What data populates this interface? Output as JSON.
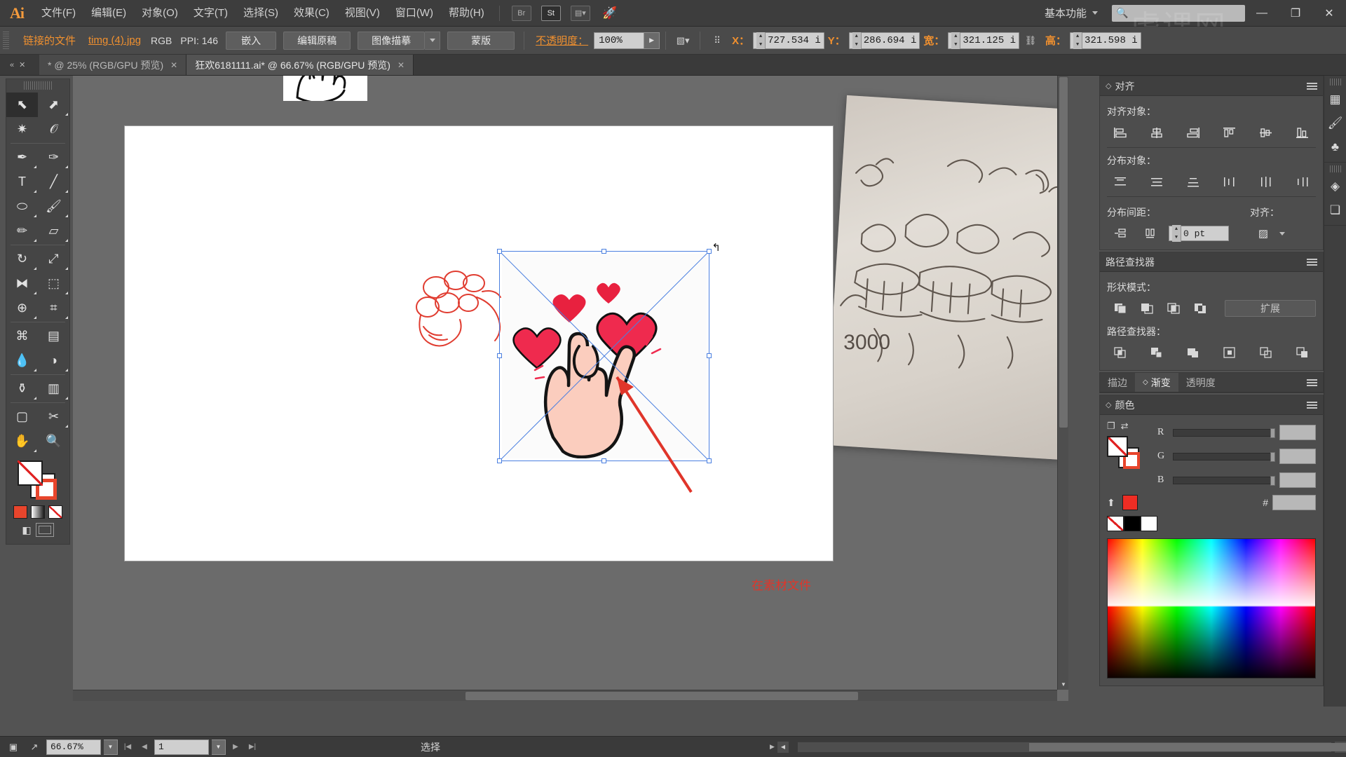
{
  "app": {
    "name": "Ai",
    "logo_text": "Ai"
  },
  "menubar": {
    "items": [
      {
        "label": "文件(F)"
      },
      {
        "label": "编辑(E)"
      },
      {
        "label": "对象(O)"
      },
      {
        "label": "文字(T)"
      },
      {
        "label": "选择(S)"
      },
      {
        "label": "效果(C)"
      },
      {
        "label": "视图(V)"
      },
      {
        "label": "窗口(W)"
      },
      {
        "label": "帮助(H)"
      }
    ],
    "bridge_label": "Br",
    "stock_label": "St",
    "arrange_icon": "arrange-documents-icon",
    "rocket_icon": "rocket-icon",
    "workspace": "基本功能",
    "search_placeholder": "",
    "window_buttons": {
      "minimize": "—",
      "restore": "❐",
      "close": "✕"
    },
    "watermark": "虎课网"
  },
  "controlbar": {
    "linked_file_label": "链接的文件",
    "filename": "timg (4).jpg",
    "colormode": "RGB",
    "ppi_label": "PPI: 146",
    "embed_button": "嵌入",
    "edit_original_button": "编辑原稿",
    "image_trace_button": "图像描摹",
    "mask_button": "蒙版",
    "opacity_label": "不透明度：",
    "opacity_value": "100%",
    "transform_icon": "transform-icon",
    "reference_point_icon": "reference-point-grid-icon",
    "x_label": "X：",
    "x_value": "727.534 i",
    "y_label": "Y：",
    "y_value": "286.694 i",
    "w_label": "宽：",
    "w_value": "321.125 i",
    "link_icon": "constrain-proportions-icon",
    "h_label": "高：",
    "h_value": "321.598 i"
  },
  "tabbar": {
    "nav_prev": "«",
    "nav_close": "✕",
    "tabs": [
      {
        "label": "* @ 25% (RGB/GPU 预览)",
        "active": false,
        "close": "✕"
      },
      {
        "label": "狂欢6181111.ai* @ 66.67% (RGB/GPU 预览)",
        "active": true,
        "close": "✕"
      }
    ]
  },
  "toolbar": {
    "tools": [
      {
        "name": "selection-tool",
        "glyph": "⬉",
        "selected": true,
        "corner": false
      },
      {
        "name": "direct-selection-tool",
        "glyph": "⬈",
        "selected": false,
        "corner": true
      },
      {
        "name": "magic-wand-tool",
        "glyph": "✷",
        "selected": false,
        "corner": false
      },
      {
        "name": "lasso-tool",
        "glyph": "𝒪",
        "selected": false,
        "corner": false
      },
      {
        "name": "pen-tool",
        "glyph": "✒",
        "selected": false,
        "corner": true
      },
      {
        "name": "curvature-tool",
        "glyph": "✑",
        "selected": false,
        "corner": true
      },
      {
        "name": "type-tool",
        "glyph": "T",
        "selected": false,
        "corner": true
      },
      {
        "name": "line-segment-tool",
        "glyph": "╱",
        "selected": false,
        "corner": true
      },
      {
        "name": "ellipse-tool",
        "glyph": "⬭",
        "selected": false,
        "corner": true
      },
      {
        "name": "paintbrush-tool",
        "glyph": "🖌",
        "selected": false,
        "corner": true
      },
      {
        "name": "pencil-tool",
        "glyph": "✏",
        "selected": false,
        "corner": true
      },
      {
        "name": "eraser-tool",
        "glyph": "▱",
        "selected": false,
        "corner": true
      },
      {
        "name": "rotate-tool",
        "glyph": "↻",
        "selected": false,
        "corner": true
      },
      {
        "name": "scale-tool",
        "glyph": "⤢",
        "selected": false,
        "corner": true
      },
      {
        "name": "width-tool",
        "glyph": "⧓",
        "selected": false,
        "corner": true
      },
      {
        "name": "free-transform-tool",
        "glyph": "⬚",
        "selected": false,
        "corner": true
      },
      {
        "name": "shape-builder-tool",
        "glyph": "⊕",
        "selected": false,
        "corner": true
      },
      {
        "name": "perspective-grid-tool",
        "glyph": "⌗",
        "selected": false,
        "corner": true
      },
      {
        "name": "mesh-tool",
        "glyph": "⌘",
        "selected": false,
        "corner": false
      },
      {
        "name": "gradient-tool",
        "glyph": "▤",
        "selected": false,
        "corner": false
      },
      {
        "name": "eyedropper-tool",
        "glyph": "💧",
        "selected": false,
        "corner": true
      },
      {
        "name": "blend-tool",
        "glyph": "◑",
        "selected": false,
        "corner": true
      },
      {
        "name": "symbol-sprayer-tool",
        "glyph": "⚱",
        "selected": false,
        "corner": true
      },
      {
        "name": "column-graph-tool",
        "glyph": "▥",
        "selected": false,
        "corner": true
      },
      {
        "name": "artboard-tool",
        "glyph": "▢",
        "selected": false,
        "corner": false
      },
      {
        "name": "slice-tool",
        "glyph": "✂",
        "selected": false,
        "corner": true
      },
      {
        "name": "hand-tool",
        "glyph": "✋",
        "selected": false,
        "corner": true
      },
      {
        "name": "zoom-tool",
        "glyph": "🔍",
        "selected": false,
        "corner": false
      }
    ],
    "fill_label": "fill-swatch",
    "stroke_label": "stroke-swatch",
    "screenmode_label": "screen-mode"
  },
  "align_panel": {
    "title": "对齐",
    "align_objects_label": "对齐对象：",
    "align_buttons": [
      {
        "name": "align-left-icon",
        "glyph": "⊨"
      },
      {
        "name": "align-horizontal-center-icon",
        "glyph": "⊥"
      },
      {
        "name": "align-right-icon",
        "glyph": "⊨"
      },
      {
        "name": "align-top-icon",
        "glyph": "⊤"
      },
      {
        "name": "align-vertical-center-icon",
        "glyph": "⊣"
      },
      {
        "name": "align-bottom-icon",
        "glyph": "⊥"
      }
    ],
    "distribute_objects_label": "分布对象：",
    "distribute_buttons": [
      {
        "name": "distribute-top-icon",
        "glyph": "≡"
      },
      {
        "name": "distribute-vertical-center-icon",
        "glyph": "≡"
      },
      {
        "name": "distribute-bottom-icon",
        "glyph": "≡"
      },
      {
        "name": "distribute-left-icon",
        "glyph": "⫴"
      },
      {
        "name": "distribute-horizontal-center-icon",
        "glyph": "⫴"
      },
      {
        "name": "distribute-right-icon",
        "glyph": "⫴"
      }
    ],
    "distribute_spacing_label": "分布间距：",
    "spacing_buttons": [
      {
        "name": "vertical-distribute-space-icon",
        "glyph": "⊐"
      },
      {
        "name": "horizontal-distribute-space-icon",
        "glyph": "⫿"
      }
    ],
    "spacing_value": "0 pt",
    "align_to_label": "对齐：",
    "align_to_icon": "align-to-selection-icon"
  },
  "pathfinder_panel": {
    "title": "路径查找器",
    "shape_modes_label": "形状模式：",
    "shape_mode_buttons": [
      {
        "name": "unite-icon",
        "glyph": "❏"
      },
      {
        "name": "minus-front-icon",
        "glyph": "❐"
      },
      {
        "name": "intersect-icon",
        "glyph": "❑"
      },
      {
        "name": "exclude-icon",
        "glyph": "❒"
      }
    ],
    "expand_button": "扩展",
    "pathfinders_label": "路径查找器：",
    "pathfinder_buttons": [
      {
        "name": "divide-icon",
        "glyph": "▣"
      },
      {
        "name": "trim-icon",
        "glyph": "▤"
      },
      {
        "name": "merge-icon",
        "glyph": "▥"
      },
      {
        "name": "crop-icon",
        "glyph": "▦"
      },
      {
        "name": "outline-icon",
        "glyph": "▧"
      },
      {
        "name": "minus-back-icon",
        "glyph": "▨"
      }
    ]
  },
  "stroke_tabs": {
    "tabs": [
      {
        "label": "描边",
        "active": false
      },
      {
        "label": "渐变",
        "active": true
      },
      {
        "label": "透明度",
        "active": false
      }
    ]
  },
  "color_panel": {
    "title": "颜色",
    "swap_icon": "swap-fill-stroke-icon",
    "default_icon": "default-fill-stroke-icon",
    "sliders": [
      {
        "label": "R",
        "value": ""
      },
      {
        "label": "G",
        "value": ""
      },
      {
        "label": "B",
        "value": ""
      }
    ],
    "hex_symbol": "#",
    "hex_value": "",
    "accent_red": "#ee2d24",
    "swatches": [
      {
        "name": "none-swatch"
      },
      {
        "name": "black-swatch"
      },
      {
        "name": "white-swatch"
      }
    ]
  },
  "dock": {
    "groups": [
      {
        "items": [
          {
            "name": "artboards-panel-icon",
            "glyph": "▦"
          },
          {
            "name": "brushes-panel-icon",
            "glyph": "🖌"
          },
          {
            "name": "symbols-panel-icon",
            "glyph": "♣"
          }
        ]
      },
      {
        "items": [
          {
            "name": "layers-panel-icon",
            "glyph": "◈"
          },
          {
            "name": "transparency-panel-icon",
            "glyph": "❏"
          }
        ]
      }
    ]
  },
  "canvas": {
    "artboard_label": "artboard",
    "linked_image_name": "timg (4).jpg",
    "annotation_text": "在素材文件",
    "arrow_color": "#e0352a"
  },
  "statusbar": {
    "device_icon": "device-preview-icon",
    "share_icon": "share-icon",
    "zoom_value": "66.67%",
    "page_value": "1",
    "status_text": "选择",
    "nav_first": "|◀",
    "nav_prev": "◀",
    "nav_next": "▶",
    "nav_last": "▶|"
  }
}
